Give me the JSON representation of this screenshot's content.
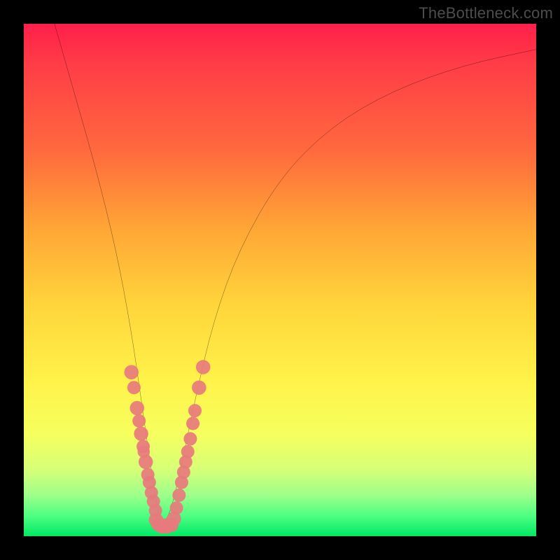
{
  "watermark": "TheBottleneck.com",
  "chart_data": {
    "type": "line",
    "title": "",
    "xlabel": "",
    "ylabel": "",
    "xlim": [
      0,
      100
    ],
    "ylim": [
      0,
      100
    ],
    "grid": false,
    "legend": false,
    "description": "V-shaped bottleneck curve over a red-to-green vertical gradient background. The curve's minimum (optimal point) sits near x≈27 on the green band; both arms rise into the red region.",
    "series": [
      {
        "name": "bottleneck-curve",
        "x": [
          6,
          10,
          14,
          18,
          21,
          23,
          25,
          26.5,
          27.5,
          29,
          31,
          33.5,
          37,
          42,
          50,
          60,
          72,
          86,
          100
        ],
        "y": [
          100,
          86,
          72,
          56,
          40,
          26,
          12,
          3,
          2.5,
          6,
          15,
          27,
          42,
          56,
          70,
          80,
          87,
          92,
          95
        ]
      }
    ],
    "scatter": {
      "name": "sample-points",
      "color": "#e87a7d",
      "points": [
        {
          "x": 21.0,
          "y": 32.0,
          "r": 1.4
        },
        {
          "x": 21.5,
          "y": 29.0,
          "r": 1.3
        },
        {
          "x": 22.1,
          "y": 25.0,
          "r": 1.4
        },
        {
          "x": 22.5,
          "y": 22.5,
          "r": 1.3
        },
        {
          "x": 22.9,
          "y": 20.0,
          "r": 1.4
        },
        {
          "x": 23.3,
          "y": 17.5,
          "r": 1.3
        },
        {
          "x": 23.4,
          "y": 16.5,
          "r": 1.2
        },
        {
          "x": 23.8,
          "y": 14.5,
          "r": 1.4
        },
        {
          "x": 24.2,
          "y": 12.0,
          "r": 1.3
        },
        {
          "x": 24.5,
          "y": 10.5,
          "r": 1.3
        },
        {
          "x": 24.9,
          "y": 8.5,
          "r": 1.3
        },
        {
          "x": 25.3,
          "y": 6.8,
          "r": 1.3
        },
        {
          "x": 25.7,
          "y": 5.0,
          "r": 1.3
        },
        {
          "x": 25.8,
          "y": 3.2,
          "r": 1.4
        },
        {
          "x": 26.3,
          "y": 2.3,
          "r": 1.4
        },
        {
          "x": 27.0,
          "y": 2.0,
          "r": 1.5
        },
        {
          "x": 27.9,
          "y": 2.0,
          "r": 1.5
        },
        {
          "x": 28.8,
          "y": 2.2,
          "r": 1.4
        },
        {
          "x": 29.3,
          "y": 3.4,
          "r": 1.4
        },
        {
          "x": 29.8,
          "y": 5.5,
          "r": 1.3
        },
        {
          "x": 30.3,
          "y": 8.0,
          "r": 1.3
        },
        {
          "x": 30.8,
          "y": 10.5,
          "r": 1.3
        },
        {
          "x": 31.2,
          "y": 12.5,
          "r": 1.3
        },
        {
          "x": 31.6,
          "y": 14.5,
          "r": 1.3
        },
        {
          "x": 32.0,
          "y": 16.5,
          "r": 1.3
        },
        {
          "x": 32.5,
          "y": 19.0,
          "r": 1.3
        },
        {
          "x": 33.0,
          "y": 22.0,
          "r": 1.3
        },
        {
          "x": 33.4,
          "y": 24.5,
          "r": 1.3
        },
        {
          "x": 34.2,
          "y": 29.0,
          "r": 1.4
        },
        {
          "x": 35.0,
          "y": 33.0,
          "r": 1.4
        }
      ]
    }
  }
}
